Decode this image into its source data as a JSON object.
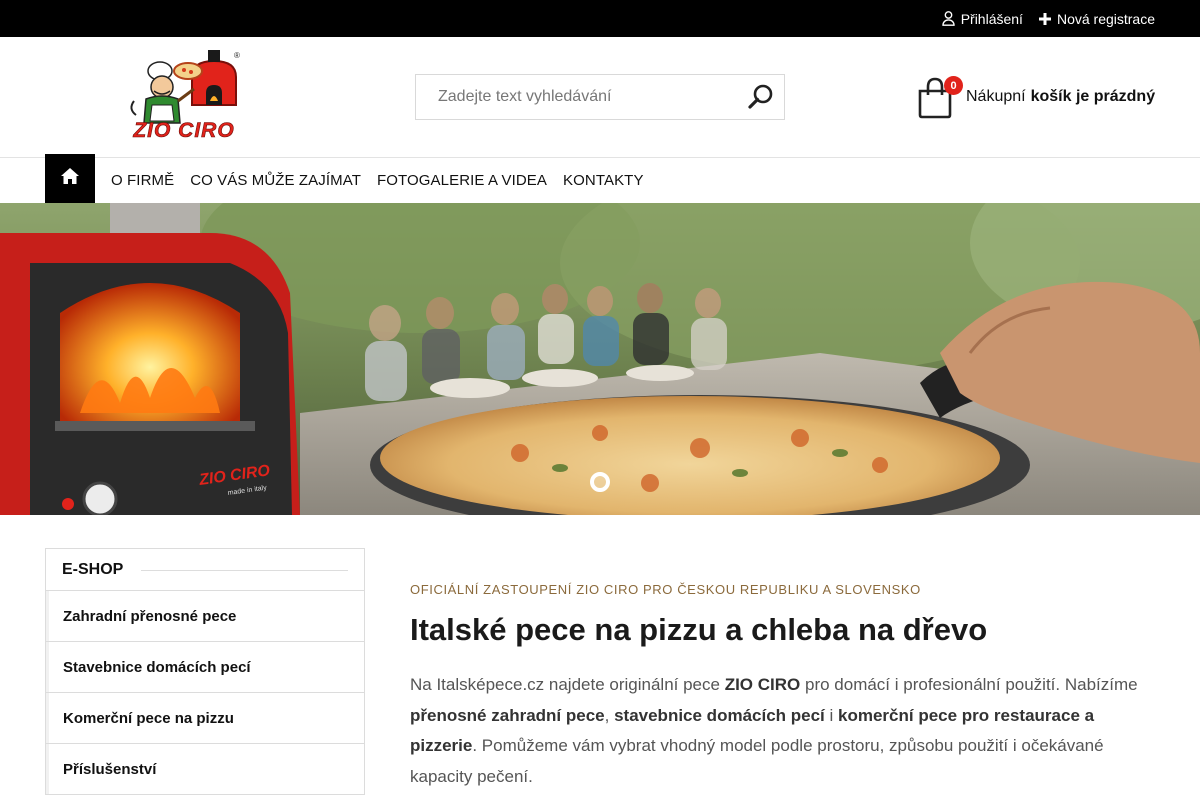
{
  "topbar": {
    "login_label": "Přihlášení",
    "register_label": "Nová registrace"
  },
  "header": {
    "logo_text": "ZIO CIRO",
    "search_placeholder": "Zadejte text vyhledávání",
    "cart": {
      "count": "0",
      "label": "Nákupní",
      "status": "košík je prázdný"
    }
  },
  "nav": {
    "home_icon": "home-icon",
    "items": [
      "O FIRMĚ",
      "CO VÁS MŮŽE ZAJÍMAT",
      "FOTOGALERIE A VIDEA",
      "KONTAKTY"
    ]
  },
  "hero": {
    "oven_brand": "ZIO CIRO",
    "oven_sub": "made in italy",
    "slides_total": 1,
    "active_slide": 1
  },
  "sidebar": {
    "title": "E-SHOP",
    "items": [
      "Zahradní přenosné pece",
      "Stavebnice domácích pecí",
      "Komerční pece na pizzu",
      "Příslušenství"
    ]
  },
  "main": {
    "eyebrow": "OFICIÁLNÍ ZASTOUPENÍ ZIO CIRO PRO ČESKOU REPUBLIKU A SLOVENSKO",
    "title": "Italské pece na pizzu a chleba na dřevo",
    "intro": {
      "t1": "Na Italsképece.cz najdete originální pece ",
      "b1": "ZIO CIRO",
      "t2": " pro domácí i profesionální použití. Nabízíme ",
      "b2": "přenosné zahradní pece",
      "t3": ", ",
      "b3": "stavebnice domácích pecí",
      "t4": " i ",
      "b4": "komerční pece pro restaurace a pizzerie",
      "t5": ". Pomůžeme vám vybrat vhodný model podle prostoru, způsobu použití i očekávané kapacity pečení."
    }
  },
  "colors": {
    "topbar_bg": "#000000",
    "accent_red": "#e1231b",
    "eyebrow": "#8b6a3c"
  }
}
